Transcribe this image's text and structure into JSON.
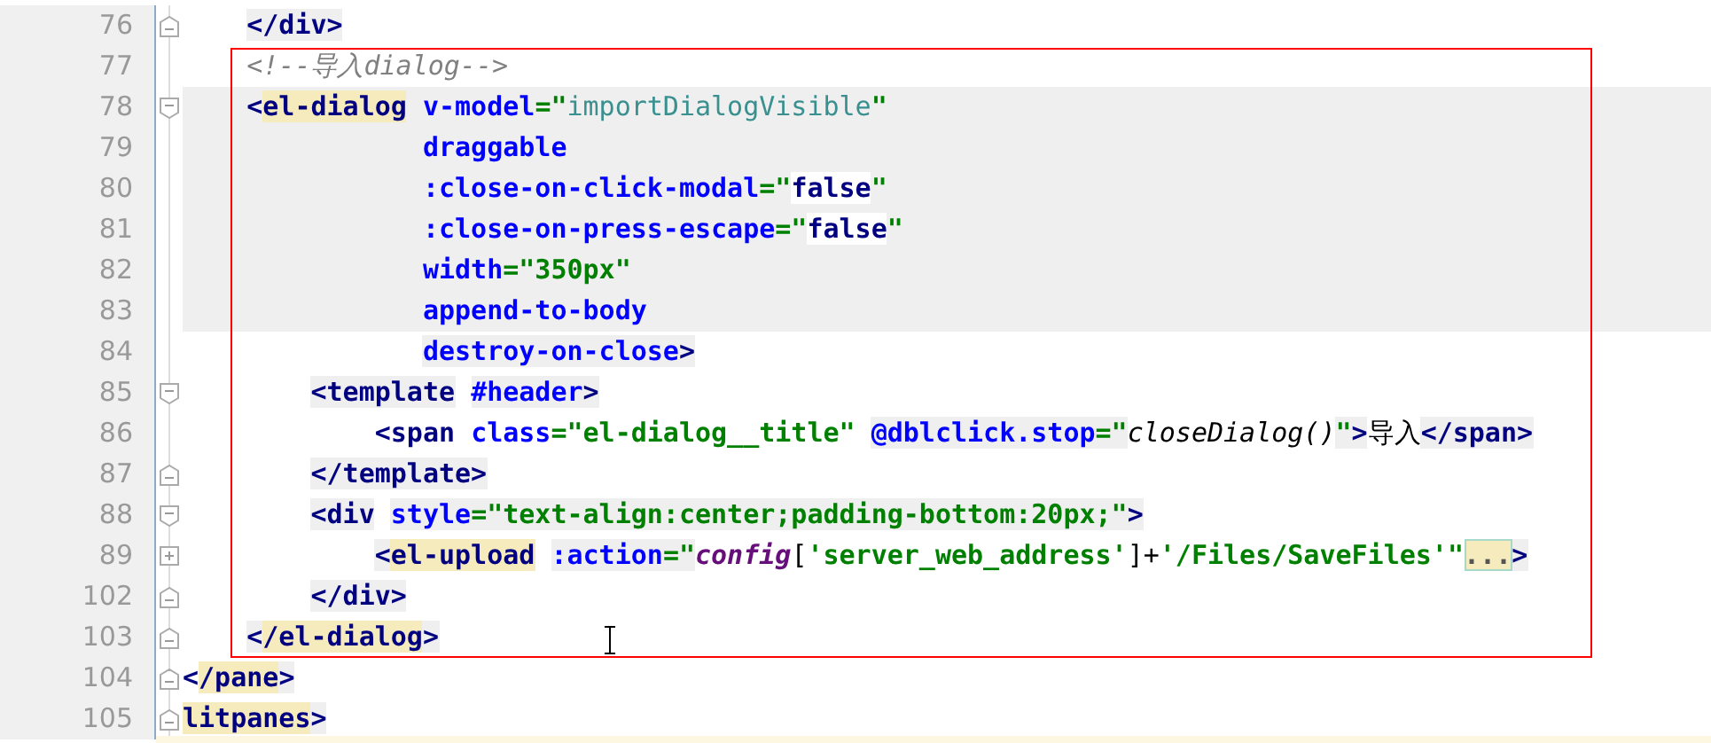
{
  "lines": [
    {
      "number": "76",
      "kind": "fold_end",
      "shaded": false,
      "tokens": [
        {
          "text": "    </div>",
          "kind": "tag",
          "shaded": true,
          "matched": false
        }
      ]
    },
    {
      "number": "77",
      "kind": "plain",
      "shaded": false,
      "tokens": [
        {
          "text": "    <!--导入dialog-->",
          "kind": "comment",
          "shaded": false,
          "matched": false
        }
      ]
    },
    {
      "number": "78",
      "kind": "fold_start",
      "shaded": true,
      "tokens": [
        {
          "text": "    <",
          "kind": "tag",
          "matched": false
        },
        {
          "text": "el-dialog",
          "kind": "tag",
          "matched": true
        },
        {
          "text": " v-model",
          "kind": "attr",
          "matched": false
        },
        {
          "text": "=\"",
          "kind": "string",
          "matched": false
        },
        {
          "text": "importDialogVisible",
          "kind": "value",
          "matched": false
        },
        {
          "text": "\"",
          "kind": "string",
          "matched": false
        }
      ]
    },
    {
      "number": "79",
      "kind": "plain",
      "shaded": true,
      "tokens": [
        {
          "text": "               draggable",
          "kind": "attr",
          "matched": false
        }
      ]
    },
    {
      "number": "80",
      "kind": "plain",
      "shaded": true,
      "tokens": [
        {
          "text": "               :close-on-click-modal",
          "kind": "attr",
          "matched": false
        },
        {
          "text": "=\"",
          "kind": "string",
          "matched": false
        },
        {
          "text": "false",
          "kind": "keyword",
          "matched": false
        },
        {
          "text": "\"",
          "kind": "string",
          "matched": false
        }
      ]
    },
    {
      "number": "81",
      "kind": "plain",
      "shaded": true,
      "tokens": [
        {
          "text": "               :close-on-press-escape",
          "kind": "attr",
          "matched": false
        },
        {
          "text": "=\"",
          "kind": "string",
          "matched": false
        },
        {
          "text": "false",
          "kind": "keyword",
          "matched": false
        },
        {
          "text": "\"",
          "kind": "string",
          "matched": false
        }
      ]
    },
    {
      "number": "82",
      "kind": "plain",
      "shaded": true,
      "tokens": [
        {
          "text": "               width",
          "kind": "attr",
          "matched": false
        },
        {
          "text": "=\"350px\"",
          "kind": "string",
          "matched": false
        }
      ]
    },
    {
      "number": "83",
      "kind": "plain",
      "shaded": true,
      "tokens": [
        {
          "text": "               append-to-body",
          "kind": "attr",
          "matched": false
        }
      ]
    },
    {
      "number": "84",
      "kind": "plain",
      "shaded": false,
      "tokens": [
        {
          "text": "               destroy-on-close",
          "kind": "attr",
          "shaded": true,
          "matched": false
        },
        {
          "text": ">",
          "kind": "tag",
          "shaded": true,
          "matched": false
        }
      ]
    },
    {
      "number": "85",
      "kind": "fold_start",
      "shaded": false,
      "tokens": [
        {
          "text": "        <template",
          "kind": "tag",
          "shaded": true,
          "matched": false
        },
        {
          "text": " #header",
          "kind": "attr",
          "shaded": true,
          "matched": false
        },
        {
          "text": ">",
          "kind": "tag",
          "shaded": true,
          "matched": false
        }
      ]
    },
    {
      "number": "86",
      "kind": "plain",
      "shaded": false,
      "tokens": [
        {
          "text": "            <span",
          "kind": "tag",
          "shaded": false,
          "matched": false
        },
        {
          "text": " class",
          "kind": "attr",
          "shaded": false,
          "matched": false
        },
        {
          "text": "=\"el-dialog__title\"",
          "kind": "string",
          "shaded": false,
          "matched": false
        },
        {
          "text": " @dblclick.stop",
          "kind": "attr",
          "shaded": true,
          "matched": false
        },
        {
          "text": "=\"",
          "kind": "string",
          "shaded": true,
          "matched": false
        },
        {
          "text": "closeDialog()",
          "kind": "expr",
          "shaded": false,
          "matched": false
        },
        {
          "text": "\"",
          "kind": "string",
          "shaded": true,
          "matched": false
        },
        {
          "text": ">",
          "kind": "tag",
          "shaded": true,
          "matched": false
        },
        {
          "text": "导入",
          "kind": "text",
          "shaded": false,
          "matched": false
        },
        {
          "text": "</span>",
          "kind": "tag",
          "shaded": true,
          "matched": false
        }
      ]
    },
    {
      "number": "87",
      "kind": "fold_end",
      "shaded": false,
      "tokens": [
        {
          "text": "        </template>",
          "kind": "tag",
          "shaded": true,
          "matched": false
        }
      ]
    },
    {
      "number": "88",
      "kind": "fold_start",
      "shaded": false,
      "tokens": [
        {
          "text": "        <div",
          "kind": "tag",
          "shaded": true,
          "matched": false
        },
        {
          "text": " style",
          "kind": "attr",
          "shaded": true,
          "matched": false
        },
        {
          "text": "=\"text-align:center;padding-bottom:20px;\"",
          "kind": "string",
          "shaded": true,
          "matched": false
        },
        {
          "text": ">",
          "kind": "tag",
          "shaded": true,
          "matched": false
        }
      ]
    },
    {
      "number": "89",
      "kind": "folded",
      "shaded": false,
      "tokens": [
        {
          "text": "            <",
          "kind": "tag",
          "shaded": true,
          "matched": false
        },
        {
          "text": "el-upload",
          "kind": "tag",
          "shaded": false,
          "matched": true
        },
        {
          "text": " :action",
          "kind": "attr",
          "shaded": true,
          "matched": false
        },
        {
          "text": "=\"",
          "kind": "string",
          "shaded": true,
          "matched": false
        },
        {
          "text": "config",
          "kind": "var",
          "shaded": false,
          "matched": false
        },
        {
          "text": "[",
          "kind": "punct",
          "shaded": false,
          "matched": false
        },
        {
          "text": "'server_web_address'",
          "kind": "string",
          "shaded": false,
          "matched": false
        },
        {
          "text": "]+",
          "kind": "punct",
          "shaded": false,
          "matched": false
        },
        {
          "text": "'/Files/SaveFiles'\"",
          "kind": "string",
          "shaded": false,
          "matched": false
        },
        {
          "text": "...",
          "kind": "ellipsis",
          "shaded": false,
          "matched": true
        },
        {
          "text": ">",
          "kind": "tag",
          "shaded": true,
          "matched": false
        }
      ]
    },
    {
      "number": "102",
      "kind": "fold_end",
      "shaded": false,
      "tokens": [
        {
          "text": "        </div>",
          "kind": "tag",
          "shaded": true,
          "matched": false
        }
      ]
    },
    {
      "number": "103",
      "kind": "fold_end",
      "shaded": false,
      "tokens": [
        {
          "text": "    <",
          "kind": "tag",
          "shaded": true,
          "matched": false
        },
        {
          "text": "/el-dialog",
          "kind": "tag",
          "shaded": false,
          "matched": true
        },
        {
          "text": ">",
          "kind": "tag",
          "shaded": true,
          "matched": false
        }
      ]
    },
    {
      "number": "104",
      "kind": "fold_end",
      "shaded": false,
      "tokens": [
        {
          "text": "<",
          "kind": "tag",
          "shaded": false,
          "matched": false
        },
        {
          "text": "/pane",
          "kind": "tag",
          "shaded": false,
          "matched": true
        },
        {
          "text": ">",
          "kind": "tag",
          "shaded": true,
          "matched": false
        }
      ]
    },
    {
      "number": "105",
      "kind": "fold_end",
      "shaded": false,
      "tokens": [
        {
          "text": "litpanes",
          "kind": "tag",
          "shaded": false,
          "matched": true
        },
        {
          "text": ">",
          "kind": "tag",
          "shaded": true,
          "matched": false
        }
      ]
    }
  ]
}
